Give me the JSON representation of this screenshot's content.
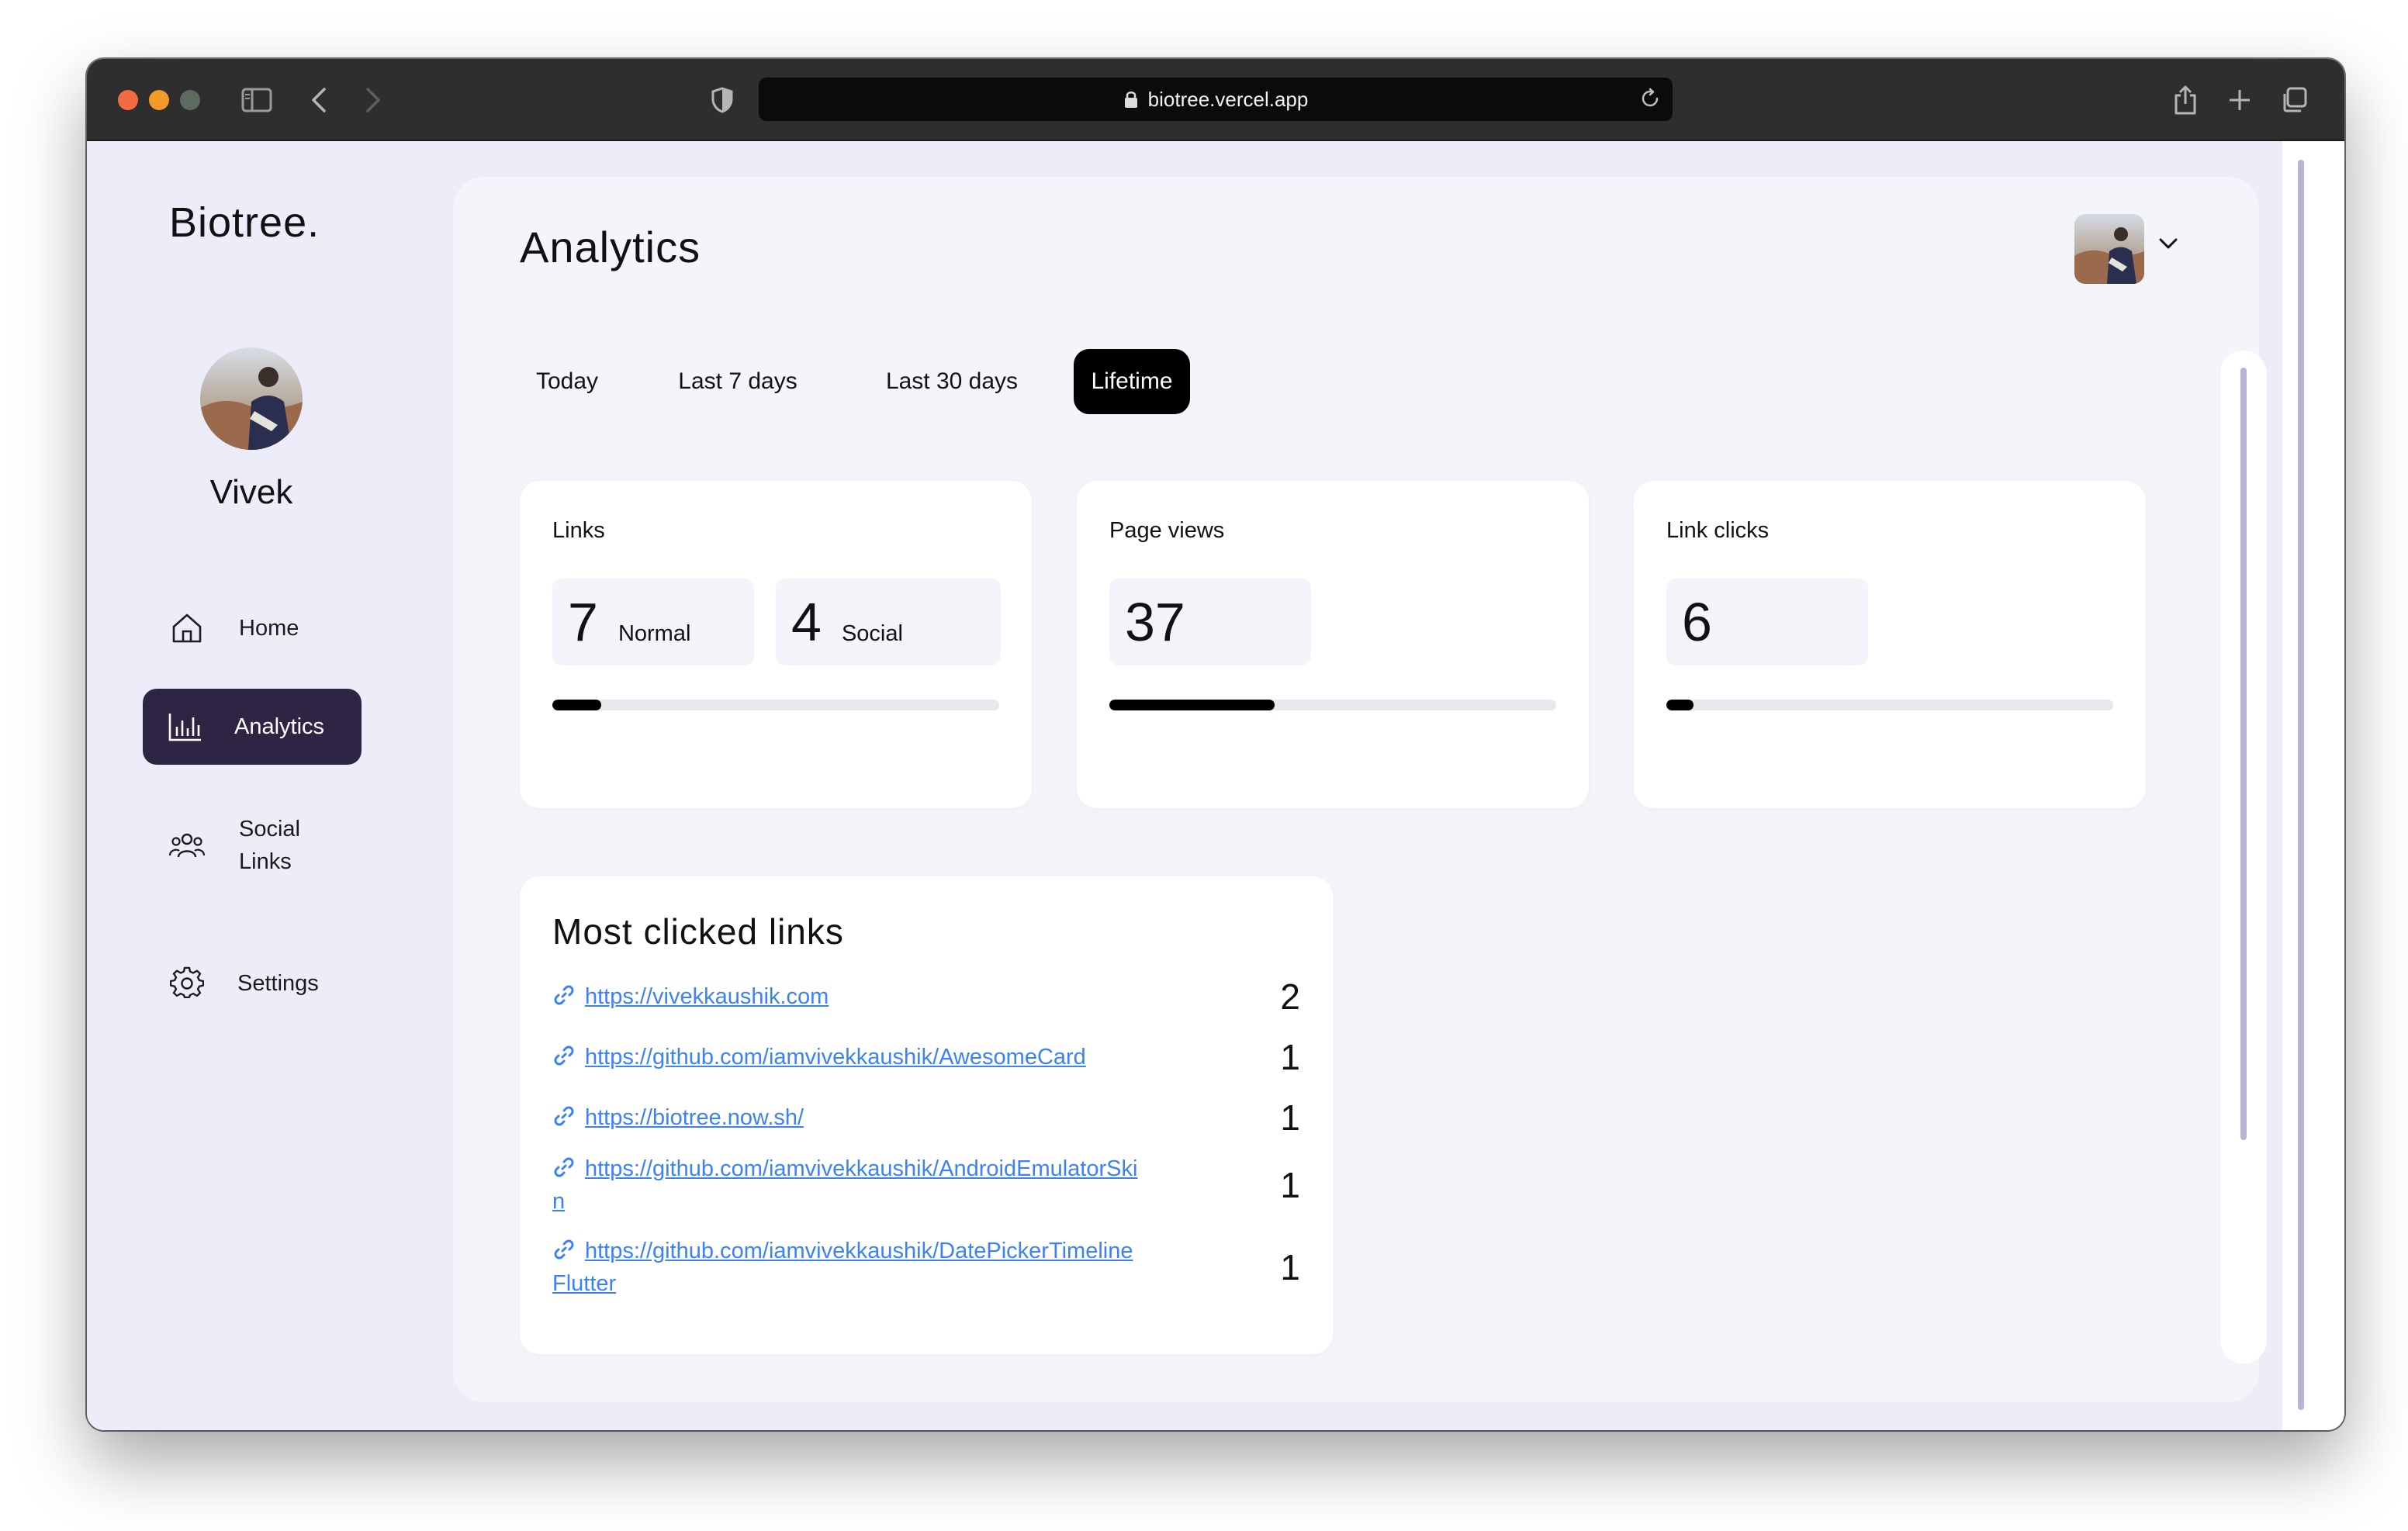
{
  "browser": {
    "url": "biotree.vercel.app"
  },
  "sidebar": {
    "brand": "Biotree.",
    "username": "Vivek",
    "items": [
      {
        "label": "Home",
        "icon": "home-icon"
      },
      {
        "label": "Analytics",
        "icon": "bar-chart-icon",
        "active": true
      },
      {
        "label": "Social\nLinks",
        "icon": "users-icon"
      },
      {
        "label": "Settings",
        "icon": "gear-icon"
      }
    ]
  },
  "header": {
    "title": "Analytics"
  },
  "tabs": [
    {
      "label": "Today"
    },
    {
      "label": "Last 7 days"
    },
    {
      "label": "Last 30 days"
    },
    {
      "label": "Lifetime",
      "active": true
    }
  ],
  "cards": {
    "links": {
      "title": "Links",
      "normal_count": "7",
      "normal_label": "Normal",
      "social_count": "4",
      "social_label": "Social",
      "progress": 0.11
    },
    "page_views": {
      "title": "Page views",
      "count": "37",
      "progress": 0.37
    },
    "link_clicks": {
      "title": "Link clicks",
      "count": "6",
      "progress": 0.06
    }
  },
  "most_clicked": {
    "title": "Most clicked links",
    "links": [
      {
        "url": "https://vivekkaushik.com",
        "count": "2"
      },
      {
        "url": "https://github.com/iamvivekkaushik/AwesomeCard",
        "count": "1"
      },
      {
        "url": "https://biotree.now.sh/",
        "count": "1"
      },
      {
        "url": "https://github.com/iamvivekkaushik/AndroidEmulatorSkin",
        "count": "1"
      },
      {
        "url": "https://github.com/iamvivekkaushik/DatePickerTimelineFlutter",
        "count": "1"
      }
    ]
  },
  "colors": {
    "accent_dark": "#2e2545",
    "link": "#3b82f6",
    "panel": "#f4f4fb",
    "background": "#ecedf8"
  }
}
